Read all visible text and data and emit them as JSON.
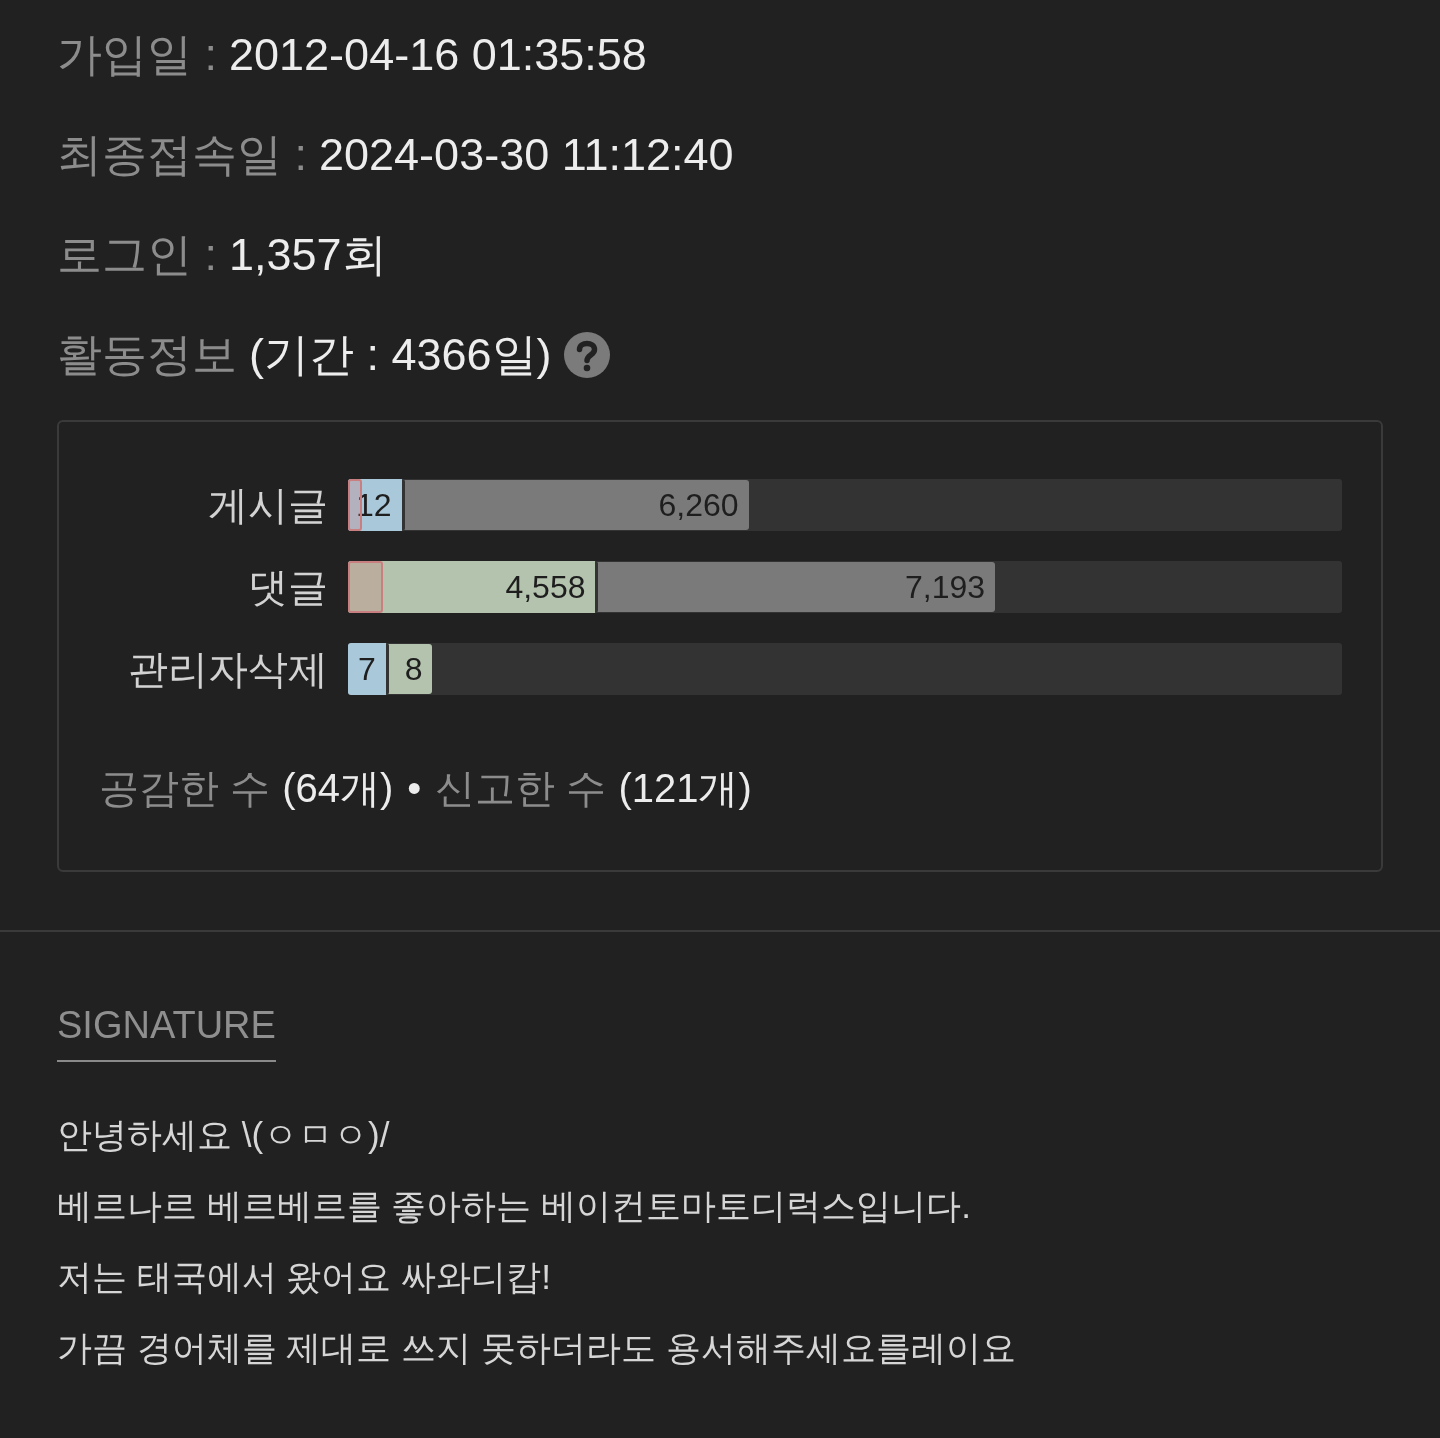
{
  "account_info": [
    {
      "label": "가입일 :",
      "value": "2012-04-16 01:35:58"
    },
    {
      "label": "최종접속일 :",
      "value": "2024-03-30 11:12:40"
    },
    {
      "label": "로그인 :",
      "value": "1,357회"
    }
  ],
  "activity": {
    "title": "활동정보",
    "period": "(기간 : 4366일)",
    "bars": [
      {
        "label": "게시글",
        "segments": [
          {
            "kind": "overlay",
            "level": 0.014
          },
          {
            "kind": "bar",
            "color": "#a9c8da",
            "level": 0.057,
            "text": "12"
          },
          {
            "kind": "bar",
            "color": "#7a7a7a",
            "level": 0.403,
            "text": "6,260"
          }
        ]
      },
      {
        "label": "댓글",
        "segments": [
          {
            "kind": "overlay",
            "level": 0.035
          },
          {
            "kind": "bar",
            "color": "#b4c3ad",
            "level": 0.252,
            "text": "4,558"
          },
          {
            "kind": "bar",
            "color": "#7a7a7a",
            "level": 0.651,
            "text": "7,193"
          }
        ]
      },
      {
        "label": "관리자삭제",
        "segments": [
          {
            "kind": "bar",
            "color": "#a9c8da",
            "level": 0.041,
            "text": "7"
          },
          {
            "kind": "bar",
            "color": "#b4c3ad",
            "level": 0.085,
            "text": "8"
          }
        ]
      }
    ],
    "stats": [
      {
        "label": "공감한 수",
        "value": "(64개)"
      },
      {
        "label": "신고한 수",
        "value": "(121개)"
      }
    ],
    "separator": "•"
  },
  "signature": {
    "title": "SIGNATURE",
    "lines": [
      "안녕하세요 \\(ㅇㅁㅇ)/",
      "베르나르 베르베르를 좋아하는 베이컨토마토디럭스입니다.",
      "저는 태국에서 왔어요 싸와디캅!",
      "가끔 경어체를 제대로 쓰지 못하더라도 용서해주세요를레이요"
    ]
  }
}
